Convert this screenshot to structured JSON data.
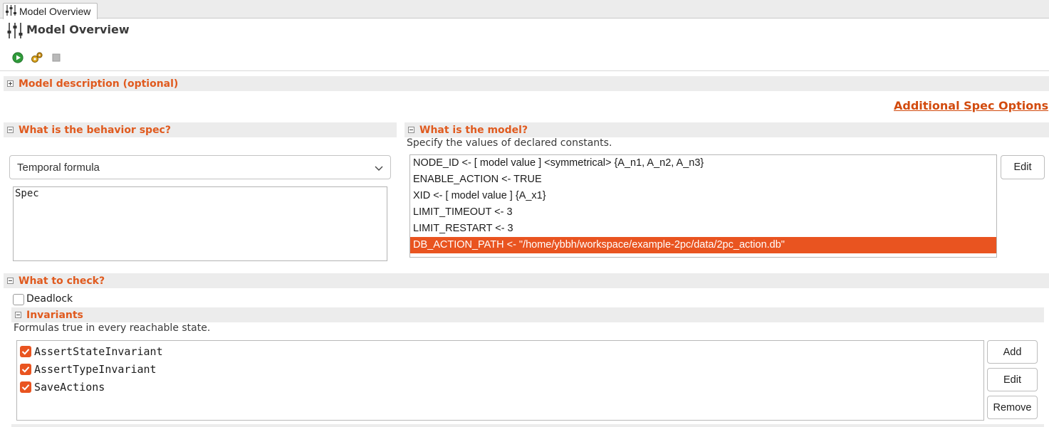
{
  "tab": {
    "label": "Model Overview",
    "icon": "sliders-icon"
  },
  "page": {
    "title": "Model Overview"
  },
  "toolbar": {
    "icons": [
      "run-icon",
      "gear-icon",
      "stop-icon"
    ]
  },
  "sections": {
    "description": {
      "title": "Model description (optional)"
    },
    "additional_link": "Additional Spec Options",
    "behavior": {
      "title": "What is the behavior spec?",
      "select_value": "Temporal formula",
      "spec_text": "Spec"
    },
    "model": {
      "title": "What is the model?",
      "subtitle": "Specify the values of declared constants.",
      "constants": [
        "NODE_ID <- [ model value ]  <symmetrical> {A_n1, A_n2, A_n3}",
        "ENABLE_ACTION <- TRUE",
        "XID <- [ model value ] {A_x1}",
        "LIMIT_TIMEOUT <- 3",
        "LIMIT_RESTART <- 3",
        "DB_ACTION_PATH <- \"/home/ybbh/workspace/example-2pc/data/2pc_action.db\""
      ],
      "selected_index": 5,
      "edit_label": "Edit"
    },
    "check": {
      "title": "What to check?",
      "deadlock_label": "Deadlock",
      "deadlock_checked": false
    },
    "invariants": {
      "title": "Invariants",
      "subtitle": "Formulas true in every reachable state.",
      "items": [
        {
          "label": "AssertStateInvariant",
          "checked": true
        },
        {
          "label": "AssertTypeInvariant",
          "checked": true
        },
        {
          "label": "SaveActions",
          "checked": true
        }
      ],
      "add_label": "Add",
      "edit_label": "Edit",
      "remove_label": "Remove"
    }
  },
  "colors": {
    "accent": "#e95420",
    "section_title": "#e05a1e",
    "link": "#d24b0e"
  }
}
